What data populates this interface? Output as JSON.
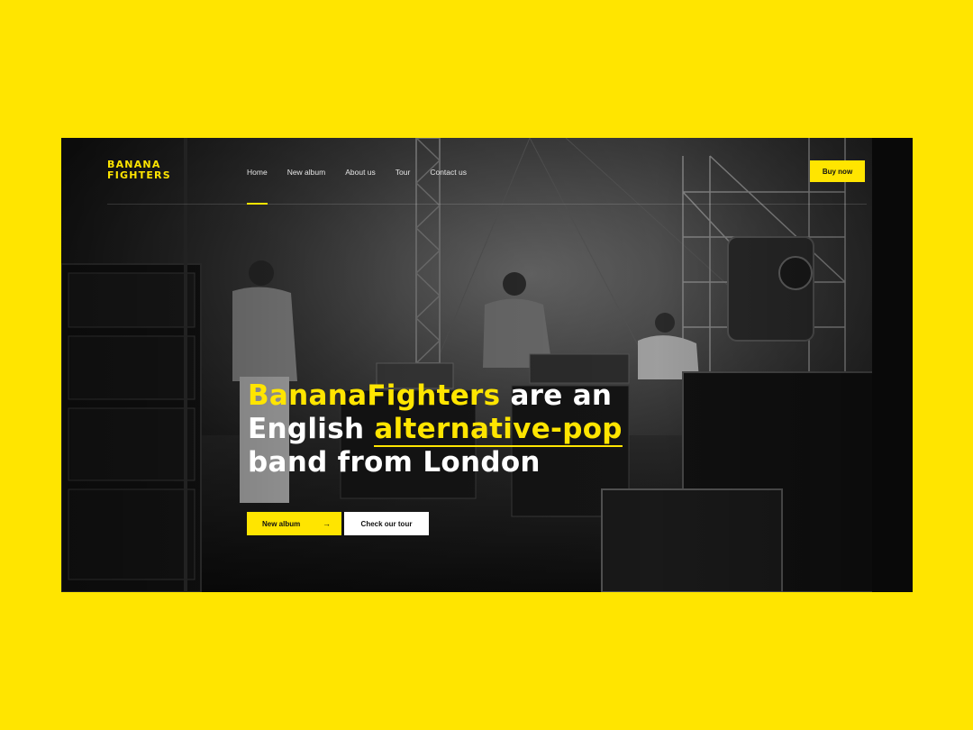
{
  "brand": {
    "logo_line1": "BANANA",
    "logo_line2": "FIGHTERS",
    "accent_color": "#ffe500"
  },
  "nav": {
    "items": [
      {
        "label": "Home",
        "active": true
      },
      {
        "label": "New album"
      },
      {
        "label": "About us"
      },
      {
        "label": "Tour"
      },
      {
        "label": "Contact us"
      }
    ]
  },
  "header": {
    "buy_label": "Buy now"
  },
  "hero": {
    "headline_part1": "BananaFighters",
    "headline_part2": " are an",
    "headline_part3": "English ",
    "headline_part4": "alternative-pop",
    "headline_part5": "band from London"
  },
  "cta": {
    "album_label": "New album",
    "album_icon": "arrow-right-icon",
    "tour_label": "Check our tour"
  }
}
